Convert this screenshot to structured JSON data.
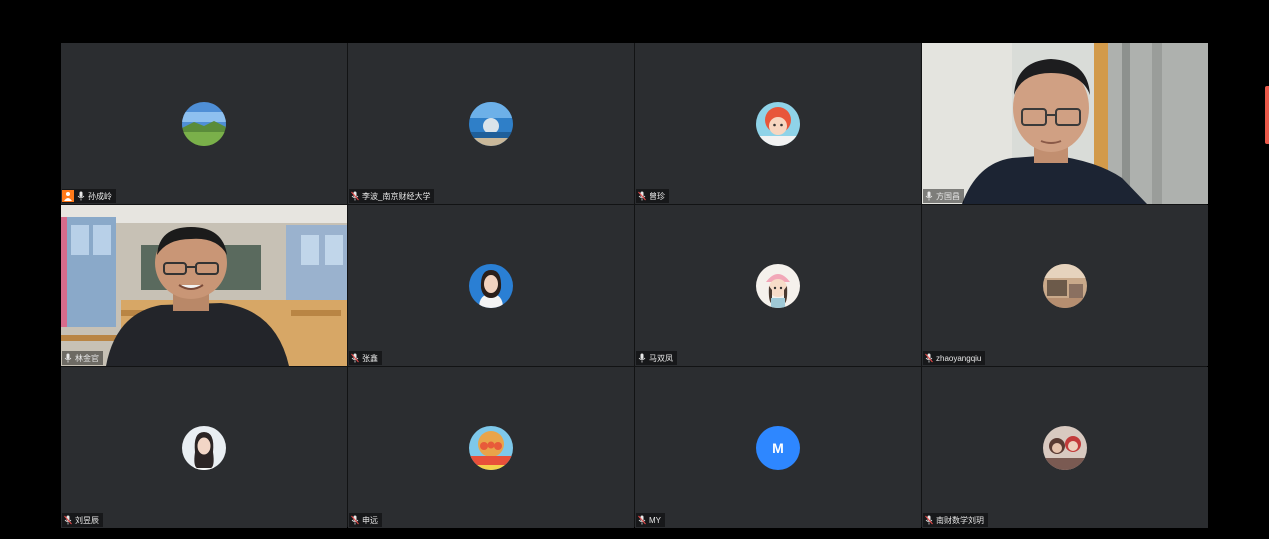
{
  "colors": {
    "background": "#000000",
    "tile": "#2b2d30",
    "host_badge": "#ff7a1a",
    "letter_avatar": "#2e87ff",
    "side_tab": "#e8594a"
  },
  "participants": [
    {
      "name": "孙成岭",
      "host": true,
      "mic": "on",
      "avatar": "landscape-avatar"
    },
    {
      "name": "李波_南京财经大学",
      "mic": "muted",
      "avatar": "seascape-avatar"
    },
    {
      "name": "曾珍",
      "mic": "muted",
      "avatar": "cartoon-girl-avatar"
    },
    {
      "name": "方国昌",
      "mic": "on",
      "video": true
    },
    {
      "name": "林金官",
      "mic": "on",
      "video": true
    },
    {
      "name": "张鑫",
      "mic": "muted",
      "avatar": "woman-portrait-avatar"
    },
    {
      "name": "马双凤",
      "mic": "on",
      "avatar": "cartoon-pink-hat-avatar"
    },
    {
      "name": "zhaoyangqiu",
      "mic": "muted",
      "avatar": "photo-avatar"
    },
    {
      "name": "刘昱辰",
      "mic": "muted",
      "avatar": "woman-portrait-avatar"
    },
    {
      "name": "申远",
      "mic": "muted",
      "avatar": "cartoon-anpanman-avatar"
    },
    {
      "name": "MY",
      "mic": "muted",
      "avatar_letter": "M"
    },
    {
      "name": "南财数学刘玥",
      "mic": "muted",
      "avatar": "group-photo-avatar"
    }
  ]
}
